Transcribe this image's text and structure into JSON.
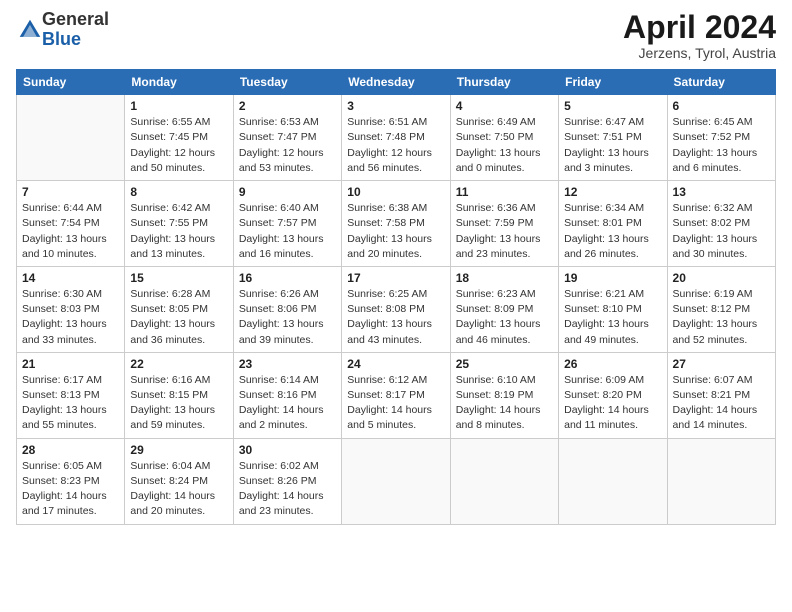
{
  "logo": {
    "general": "General",
    "blue": "Blue"
  },
  "title": "April 2024",
  "location": "Jerzens, Tyrol, Austria",
  "weekdays": [
    "Sunday",
    "Monday",
    "Tuesday",
    "Wednesday",
    "Thursday",
    "Friday",
    "Saturday"
  ],
  "weeks": [
    [
      {
        "day": "",
        "info": ""
      },
      {
        "day": "1",
        "info": "Sunrise: 6:55 AM\nSunset: 7:45 PM\nDaylight: 12 hours\nand 50 minutes."
      },
      {
        "day": "2",
        "info": "Sunrise: 6:53 AM\nSunset: 7:47 PM\nDaylight: 12 hours\nand 53 minutes."
      },
      {
        "day": "3",
        "info": "Sunrise: 6:51 AM\nSunset: 7:48 PM\nDaylight: 12 hours\nand 56 minutes."
      },
      {
        "day": "4",
        "info": "Sunrise: 6:49 AM\nSunset: 7:50 PM\nDaylight: 13 hours\nand 0 minutes."
      },
      {
        "day": "5",
        "info": "Sunrise: 6:47 AM\nSunset: 7:51 PM\nDaylight: 13 hours\nand 3 minutes."
      },
      {
        "day": "6",
        "info": "Sunrise: 6:45 AM\nSunset: 7:52 PM\nDaylight: 13 hours\nand 6 minutes."
      }
    ],
    [
      {
        "day": "7",
        "info": "Sunrise: 6:44 AM\nSunset: 7:54 PM\nDaylight: 13 hours\nand 10 minutes."
      },
      {
        "day": "8",
        "info": "Sunrise: 6:42 AM\nSunset: 7:55 PM\nDaylight: 13 hours\nand 13 minutes."
      },
      {
        "day": "9",
        "info": "Sunrise: 6:40 AM\nSunset: 7:57 PM\nDaylight: 13 hours\nand 16 minutes."
      },
      {
        "day": "10",
        "info": "Sunrise: 6:38 AM\nSunset: 7:58 PM\nDaylight: 13 hours\nand 20 minutes."
      },
      {
        "day": "11",
        "info": "Sunrise: 6:36 AM\nSunset: 7:59 PM\nDaylight: 13 hours\nand 23 minutes."
      },
      {
        "day": "12",
        "info": "Sunrise: 6:34 AM\nSunset: 8:01 PM\nDaylight: 13 hours\nand 26 minutes."
      },
      {
        "day": "13",
        "info": "Sunrise: 6:32 AM\nSunset: 8:02 PM\nDaylight: 13 hours\nand 30 minutes."
      }
    ],
    [
      {
        "day": "14",
        "info": "Sunrise: 6:30 AM\nSunset: 8:03 PM\nDaylight: 13 hours\nand 33 minutes."
      },
      {
        "day": "15",
        "info": "Sunrise: 6:28 AM\nSunset: 8:05 PM\nDaylight: 13 hours\nand 36 minutes."
      },
      {
        "day": "16",
        "info": "Sunrise: 6:26 AM\nSunset: 8:06 PM\nDaylight: 13 hours\nand 39 minutes."
      },
      {
        "day": "17",
        "info": "Sunrise: 6:25 AM\nSunset: 8:08 PM\nDaylight: 13 hours\nand 43 minutes."
      },
      {
        "day": "18",
        "info": "Sunrise: 6:23 AM\nSunset: 8:09 PM\nDaylight: 13 hours\nand 46 minutes."
      },
      {
        "day": "19",
        "info": "Sunrise: 6:21 AM\nSunset: 8:10 PM\nDaylight: 13 hours\nand 49 minutes."
      },
      {
        "day": "20",
        "info": "Sunrise: 6:19 AM\nSunset: 8:12 PM\nDaylight: 13 hours\nand 52 minutes."
      }
    ],
    [
      {
        "day": "21",
        "info": "Sunrise: 6:17 AM\nSunset: 8:13 PM\nDaylight: 13 hours\nand 55 minutes."
      },
      {
        "day": "22",
        "info": "Sunrise: 6:16 AM\nSunset: 8:15 PM\nDaylight: 13 hours\nand 59 minutes."
      },
      {
        "day": "23",
        "info": "Sunrise: 6:14 AM\nSunset: 8:16 PM\nDaylight: 14 hours\nand 2 minutes."
      },
      {
        "day": "24",
        "info": "Sunrise: 6:12 AM\nSunset: 8:17 PM\nDaylight: 14 hours\nand 5 minutes."
      },
      {
        "day": "25",
        "info": "Sunrise: 6:10 AM\nSunset: 8:19 PM\nDaylight: 14 hours\nand 8 minutes."
      },
      {
        "day": "26",
        "info": "Sunrise: 6:09 AM\nSunset: 8:20 PM\nDaylight: 14 hours\nand 11 minutes."
      },
      {
        "day": "27",
        "info": "Sunrise: 6:07 AM\nSunset: 8:21 PM\nDaylight: 14 hours\nand 14 minutes."
      }
    ],
    [
      {
        "day": "28",
        "info": "Sunrise: 6:05 AM\nSunset: 8:23 PM\nDaylight: 14 hours\nand 17 minutes."
      },
      {
        "day": "29",
        "info": "Sunrise: 6:04 AM\nSunset: 8:24 PM\nDaylight: 14 hours\nand 20 minutes."
      },
      {
        "day": "30",
        "info": "Sunrise: 6:02 AM\nSunset: 8:26 PM\nDaylight: 14 hours\nand 23 minutes."
      },
      {
        "day": "",
        "info": ""
      },
      {
        "day": "",
        "info": ""
      },
      {
        "day": "",
        "info": ""
      },
      {
        "day": "",
        "info": ""
      }
    ]
  ]
}
